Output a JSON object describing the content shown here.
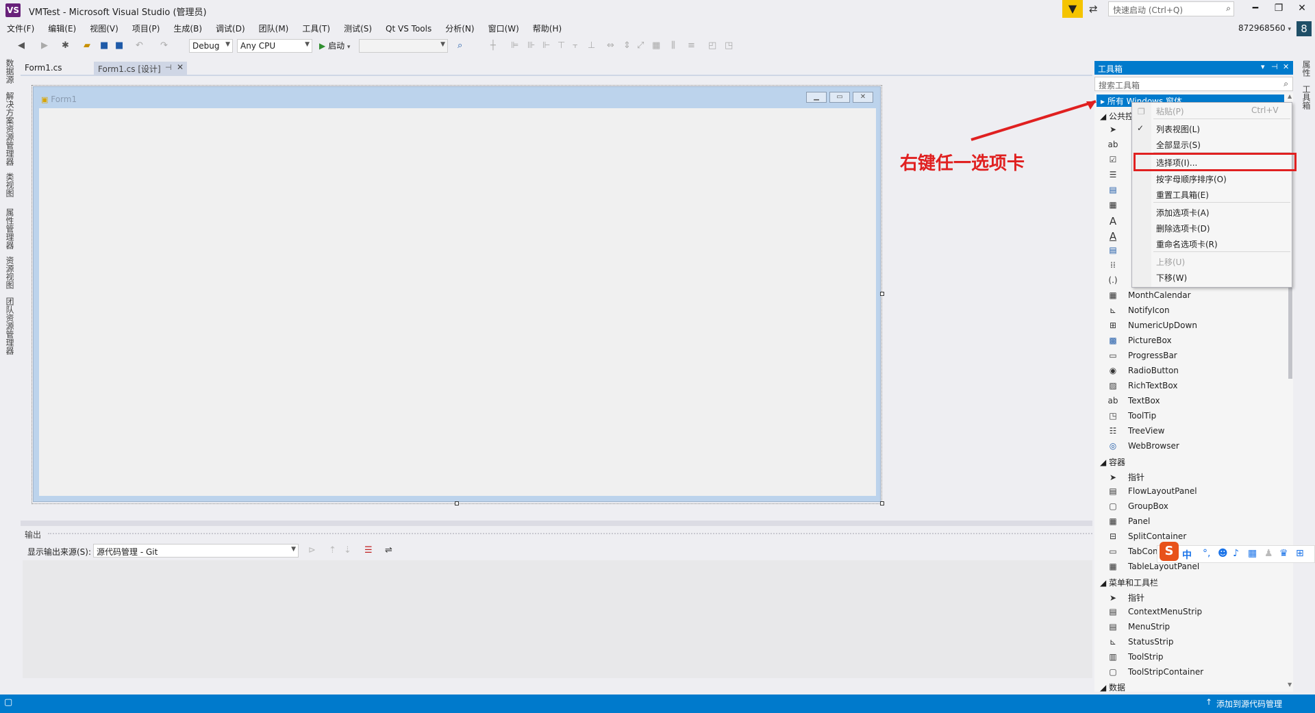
{
  "titlebar": {
    "logo_text": "VS",
    "title": "VMTest - Microsoft Visual Studio (管理员)",
    "quick_launch_placeholder": "快速启动 (Ctrl+Q)",
    "account": "872968560",
    "account_badge": "8"
  },
  "menu": [
    "文件(F)",
    "编辑(E)",
    "视图(V)",
    "项目(P)",
    "生成(B)",
    "调试(D)",
    "团队(M)",
    "工具(T)",
    "测试(S)",
    "Qt VS Tools",
    "分析(N)",
    "窗口(W)",
    "帮助(H)"
  ],
  "toolbar": {
    "config": "Debug",
    "platform": "Any CPU",
    "start_label": "启动"
  },
  "left_tabs": [
    "数据源",
    "解决方案资源管理器",
    "类视图",
    "属性管理器",
    "资源视图",
    "团队资源管理器"
  ],
  "right_tabs": [
    "属性",
    "工具箱"
  ],
  "doc_tabs": [
    "Form1.cs",
    "Form1.cs [设计]"
  ],
  "form": {
    "caption": "Form1"
  },
  "output": {
    "title": "输出",
    "source_label": "显示输出来源(S):",
    "source_value": "源代码管理 - Git"
  },
  "toolbox": {
    "title": "工具箱",
    "search_placeholder": "搜索工具箱",
    "selected_category": "所有 Windows 窗体",
    "category_common": "公共控件",
    "items_top": [
      "MonthCalendar",
      "NotifyIcon",
      "NumericUpDown",
      "PictureBox",
      "ProgressBar",
      "RadioButton",
      "RichTextBox",
      "TextBox",
      "ToolTip",
      "TreeView",
      "WebBrowser"
    ],
    "category_containers": "容器",
    "containers": [
      "指针",
      "FlowLayoutPanel",
      "GroupBox",
      "Panel",
      "SplitContainer",
      "TabControl",
      "TableLayoutPanel"
    ],
    "category_menus": "菜单和工具栏",
    "menus": [
      "指针",
      "ContextMenuStrip",
      "MenuStrip",
      "StatusStrip",
      "ToolStrip",
      "ToolStripContainer"
    ],
    "category_data": "数据"
  },
  "context_menu": {
    "paste": "粘贴(P)",
    "paste_shortcut": "Ctrl+V",
    "list_view": "列表视图(L)",
    "show_all": "全部显示(S)",
    "choose_items": "选择项(I)...",
    "sort_alpha": "按字母顺序排序(O)",
    "reset_toolbox": "重置工具箱(E)",
    "add_tab": "添加选项卡(A)",
    "delete_tab": "删除选项卡(D)",
    "rename_tab": "重命名选项卡(R)",
    "move_up": "上移(U)",
    "move_down": "下移(W)"
  },
  "annotation": "右键任一选项卡",
  "ime": {
    "logo": "S",
    "mode": "中"
  },
  "status": {
    "text": "添加到源代码管理"
  },
  "colors": {
    "accent": "#007acc",
    "annotation": "#e02020",
    "filter": "#f5c400"
  }
}
